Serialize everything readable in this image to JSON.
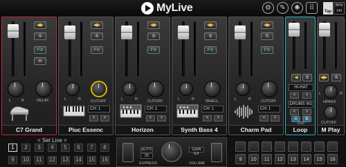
{
  "app": {
    "title": "MyLive"
  },
  "header": {
    "icons": [
      "gear-icon",
      "wrench-icon",
      "settings-dial-icon",
      "dots-grid-icon"
    ],
    "tap_label": "Tap",
    "bpm_label": "BPM",
    "bpm_value": "140"
  },
  "strips": [
    {
      "name": "C7 Grand",
      "selected": "red",
      "buttons": [
        "◀▶",
        "S",
        "FX",
        "⊙"
      ],
      "knob_label": "DELAY",
      "knob_left_label": "L",
      "knob_right_label": "R",
      "instrument": "piano"
    },
    {
      "name": "Piuc Essenc",
      "buttons": [
        "◀▶",
        "S",
        "FX"
      ],
      "knob_label": "CUTOFF",
      "knob_left_label": "L",
      "knob_right_label": "R",
      "ch_label": "CH:",
      "ch_value": "1",
      "instrument": "keyboard"
    },
    {
      "name": "Horizon",
      "buttons": [
        "◀▶",
        "S",
        "FX"
      ],
      "knob_label": "CUTOFF",
      "knob_left_label": "L",
      "knob_right_label": "R",
      "ch_label": "CH:",
      "ch_value": "1",
      "instrument": "synth"
    },
    {
      "name": "Synth Bass 4",
      "buttons": [
        "◀▶",
        "S",
        "FX"
      ],
      "knob_label": "WHELL",
      "knob_left_label": "L",
      "knob_right_label": "R",
      "ch_label": "CH:",
      "ch_value": "1",
      "instrument": "synth"
    },
    {
      "name": "Charm Pad",
      "buttons": [
        "◀▶",
        "S",
        "FX"
      ],
      "knob_label": "CUTOFF",
      "knob_left_label": "L",
      "knob_right_label": "R",
      "ch_label": "CH:",
      "ch_value": "1",
      "instrument": "waveform"
    },
    {
      "name": "Loop",
      "selected": "cyan",
      "hihat_label": "HI-HAT",
      "drums_label": "DRUMS W1",
      "loop_a": "A",
      "loop_b": "B",
      "od_label": "O/D"
    },
    {
      "name": "M Play",
      "buttons": [
        "◀▶",
        "S"
      ],
      "knob1_label": "HPASS",
      "knob2_label": "CUTOFF",
      "knob_left_label": "L",
      "knob_right_label": "R"
    }
  ],
  "setlive": {
    "label": "< Set Live >",
    "active": "1",
    "row1": [
      "1",
      "2",
      "3",
      "4",
      "5",
      "6",
      "7",
      "8"
    ],
    "row2": [
      "9",
      "10",
      "11",
      "12",
      "13",
      "14",
      "15",
      "16"
    ]
  },
  "center_panel": {
    "auto_label": "AUTO",
    "auto_value": "25",
    "express_label": "EXPRESS",
    "gain_label": "GAIN EX",
    "volume_label": "VOLUME"
  },
  "grid_pads": {
    "row1": [
      "",
      "",
      "",
      "",
      "",
      "",
      "",
      ""
    ],
    "row2": [
      "9",
      "10",
      "11",
      "12",
      "13",
      "14",
      "15",
      "16"
    ]
  },
  "colors": {
    "selected_red": "#c0303a",
    "selected_cyan": "#2fb7c0",
    "mute_yellow": "#f0c040",
    "fx_cyan": "#5fd0e0",
    "knob_yellow": "#d8b800"
  }
}
